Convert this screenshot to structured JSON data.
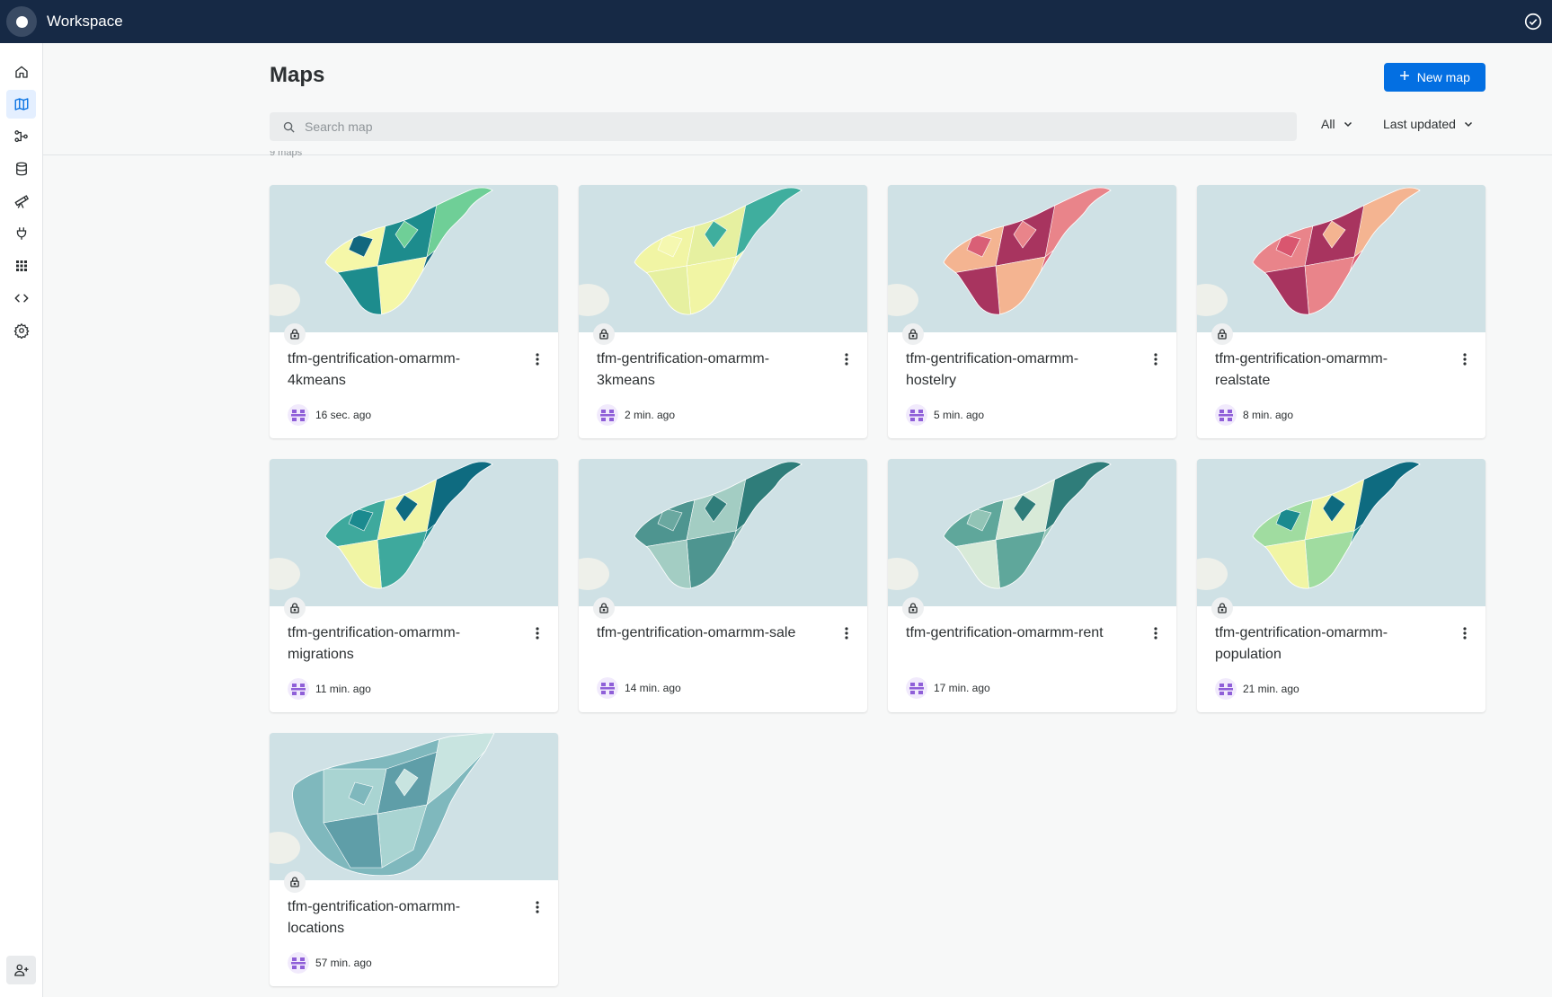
{
  "app": {
    "title": "Workspace"
  },
  "nav": {
    "items": [
      {
        "name": "home",
        "icon": "home-icon"
      },
      {
        "name": "maps",
        "icon": "map-icon",
        "active": true
      },
      {
        "name": "workflows",
        "icon": "workflow-icon"
      },
      {
        "name": "data-explorer",
        "icon": "database-icon"
      },
      {
        "name": "data-observatory",
        "icon": "telescope-icon"
      },
      {
        "name": "connections",
        "icon": "plug-icon"
      },
      {
        "name": "applications",
        "icon": "grid-icon"
      },
      {
        "name": "developers",
        "icon": "code-icon"
      },
      {
        "name": "settings",
        "icon": "gear-icon"
      }
    ],
    "bottom_icon": "add-user-icon"
  },
  "page": {
    "title": "Maps",
    "new_map_label": "New map",
    "search_placeholder": "Search map",
    "filter_value": "All",
    "sort_value": "Last updated",
    "count_text": "9 maps"
  },
  "colors": {
    "topbar": "#162945",
    "primary": "#036fe2",
    "sea": "#cfe1e5",
    "avatar": "#8f5fd8"
  },
  "maps": [
    {
      "title": "tfm-gentrification-omarmm-4kmeans",
      "updated": "16 sec. ago",
      "palette": [
        "#12677e",
        "#f5f7a8",
        "#1d8c8d",
        "#6fcf97"
      ]
    },
    {
      "title": "tfm-gentrification-omarmm-3kmeans",
      "updated": "2 min. ago",
      "palette": [
        "#f5f8b0",
        "#f1f5a4",
        "#e6f0a0",
        "#3fae9e"
      ]
    },
    {
      "title": "tfm-gentrification-omarmm-hostelry",
      "updated": "5 min. ago",
      "palette": [
        "#d95f76",
        "#f4b491",
        "#a8345f",
        "#e9848a"
      ]
    },
    {
      "title": "tfm-gentrification-omarmm-realstate",
      "updated": "8 min. ago",
      "palette": [
        "#d9566f",
        "#e9848a",
        "#a8345f",
        "#f4b491"
      ]
    },
    {
      "title": "tfm-gentrification-omarmm-migrations",
      "updated": "11 min. ago",
      "palette": [
        "#1b8a8f",
        "#3ea99d",
        "#f1f5a4",
        "#0e6b80"
      ]
    },
    {
      "title": "tfm-gentrification-omarmm-sale",
      "updated": "14 min. ago",
      "palette": [
        "#6aa8a0",
        "#4e9590",
        "#a3cdc3",
        "#2f7d7a"
      ]
    },
    {
      "title": "tfm-gentrification-omarmm-rent",
      "updated": "17 min. ago",
      "palette": [
        "#92c4b6",
        "#5fa79b",
        "#d8ead8",
        "#2f7d7a"
      ]
    },
    {
      "title": "tfm-gentrification-omarmm-population",
      "updated": "21 min. ago",
      "palette": [
        "#1b8a8f",
        "#a0dca0",
        "#f1f5a4",
        "#0e6b80"
      ]
    },
    {
      "title": "tfm-gentrification-omarmm-locations",
      "updated": "57 min. ago",
      "palette": [
        "#7fb8bd",
        "#a9d4d2",
        "#5f9ea8",
        "#c8e4e0"
      ]
    }
  ]
}
